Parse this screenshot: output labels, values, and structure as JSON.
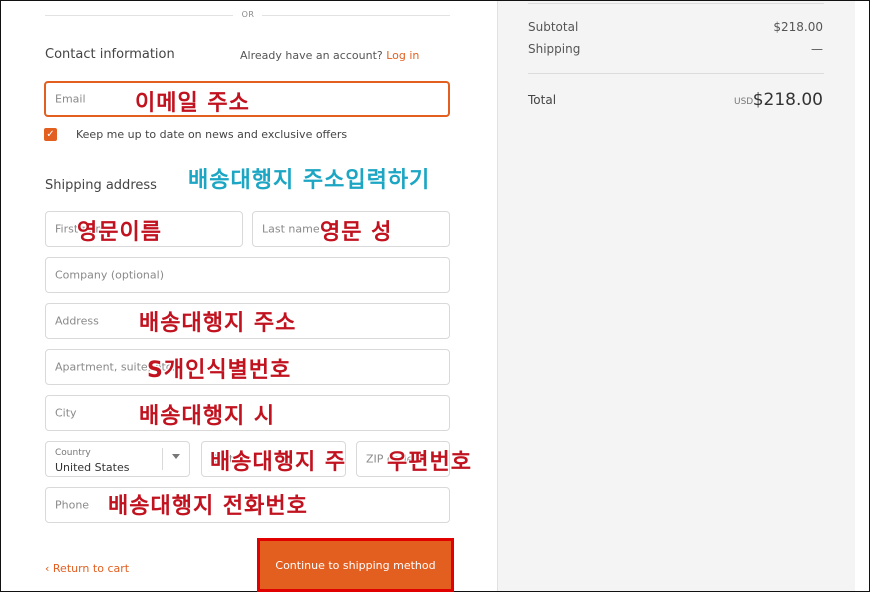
{
  "divider": {
    "or_text": "OR"
  },
  "contact": {
    "title": "Contact information",
    "account_prompt": "Already have an account?",
    "login_link": "Log in",
    "email_placeholder": "Email",
    "newsletter_label": "Keep me up to date on news and exclusive offers",
    "newsletter_checked": true
  },
  "shipping": {
    "title": "Shipping address",
    "first_name_placeholder": "First name",
    "last_name_placeholder": "Last name",
    "company_placeholder": "Company (optional)",
    "address_placeholder": "Address",
    "apartment_placeholder": "Apartment, suite, etc.",
    "city_placeholder": "City",
    "country_label": "Country",
    "country_value": "United States",
    "state_placeholder": "State",
    "zip_placeholder": "ZIP code",
    "phone_placeholder": "Phone"
  },
  "annotations": {
    "email": "이메일 주소",
    "shipping_heading": "배송대행지 주소입력하기",
    "first_name": "영문이름",
    "last_name": "영문 성",
    "address": "배송대행지 주소",
    "apartment": "S개인식별번호",
    "city": "배송대행지 시",
    "state": "배송대행지 주",
    "zip": "우편번호",
    "phone": "배송대행지 전화번호"
  },
  "footer": {
    "return_link": "Return to cart",
    "continue_button": "Continue to shipping method"
  },
  "summary": {
    "subtotal_label": "Subtotal",
    "subtotal_value": "$218.00",
    "shipping_label": "Shipping",
    "shipping_value": "—",
    "total_label": "Total",
    "total_currency": "USD",
    "total_value": "$218.00"
  },
  "colors": {
    "accent": "#e25f20",
    "annotation_red": "#c1121f",
    "annotation_blue": "#1ca6c4",
    "summary_bg": "#f4f4f4"
  },
  "icons": {
    "checkbox": "checkmark-icon",
    "return": "chevron-left-icon",
    "select": "chevron-down-icon"
  }
}
